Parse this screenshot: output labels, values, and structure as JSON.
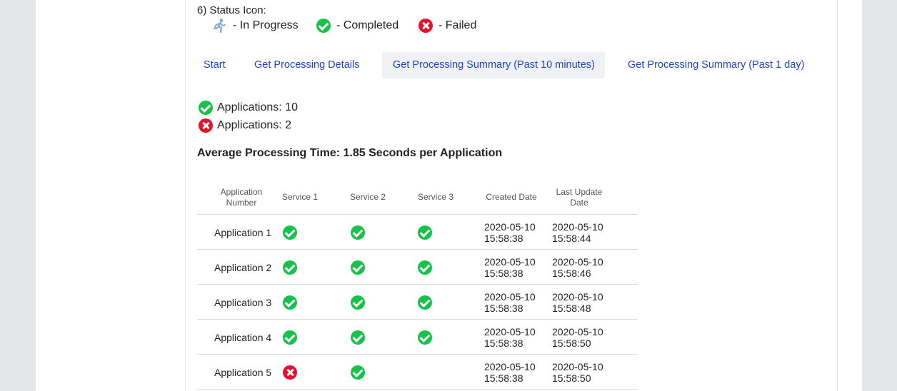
{
  "legend": {
    "title": "6) Status Icon:",
    "in_progress_label": "- In Progress",
    "completed_label": "- Completed",
    "failed_label": "- Failed"
  },
  "tabs": [
    {
      "label": "Start",
      "active": false
    },
    {
      "label": "Get Processing Details",
      "active": false
    },
    {
      "label": "Get Processing Summary (Past 10 minutes)",
      "active": true
    },
    {
      "label": "Get Processing Summary (Past 1 day)",
      "active": false
    }
  ],
  "summary": {
    "completed_text": "Applications: 10",
    "failed_text": "Applications: 2"
  },
  "average": "Average Processing Time: 1.85 Seconds per Application",
  "table": {
    "headers": {
      "app_number": "Application Number",
      "service1": "Service 1",
      "service2": "Service 2",
      "service3": "Service 3",
      "created": "Created Date",
      "updated": "Last Update Date"
    },
    "rows": [
      {
        "app": "Application 1",
        "s1": "completed",
        "s2": "completed",
        "s3": "completed",
        "created_date": "2020-05-10",
        "created_time": "15:58:38",
        "updated_date": "2020-05-10",
        "updated_time": "15:58:44"
      },
      {
        "app": "Application 2",
        "s1": "completed",
        "s2": "completed",
        "s3": "completed",
        "created_date": "2020-05-10",
        "created_time": "15:58:38",
        "updated_date": "2020-05-10",
        "updated_time": "15:58:46"
      },
      {
        "app": "Application 3",
        "s1": "completed",
        "s2": "completed",
        "s3": "completed",
        "created_date": "2020-05-10",
        "created_time": "15:58:38",
        "updated_date": "2020-05-10",
        "updated_time": "15:58:48"
      },
      {
        "app": "Application 4",
        "s1": "completed",
        "s2": "completed",
        "s3": "completed",
        "created_date": "2020-05-10",
        "created_time": "15:58:38",
        "updated_date": "2020-05-10",
        "updated_time": "15:58:50"
      },
      {
        "app": "Application 5",
        "s1": "failed",
        "s2": "completed",
        "s3": "",
        "created_date": "2020-05-10",
        "created_time": "15:58:38",
        "updated_date": "2020-05-10",
        "updated_time": "15:58:50"
      }
    ]
  },
  "colors": {
    "completed": "#15c24a",
    "failed": "#e8102c",
    "link": "#1d44c6"
  },
  "icons": {
    "in_progress": "running-person-icon",
    "completed": "check-circle-icon",
    "failed": "x-circle-icon"
  }
}
